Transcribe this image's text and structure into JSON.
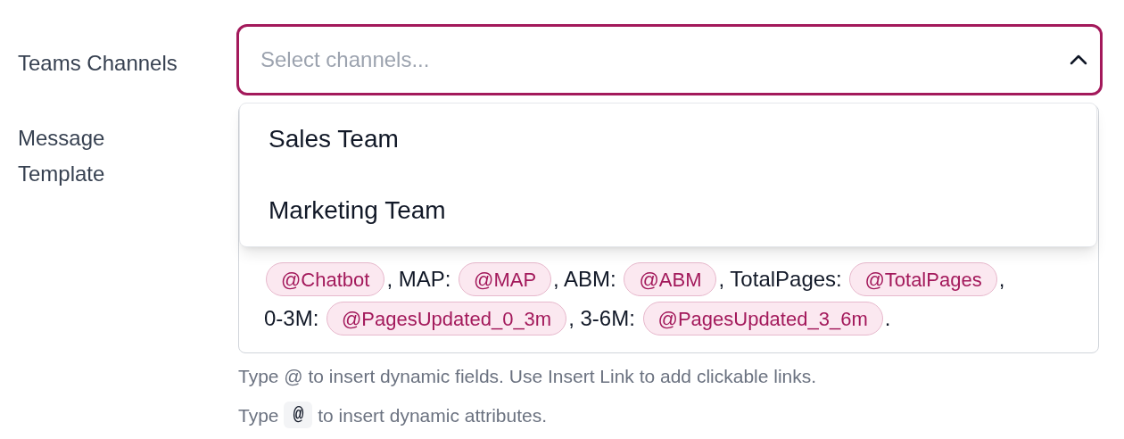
{
  "channels_field": {
    "label": "Teams Channels",
    "placeholder": "Select channels...",
    "expanded": true,
    "options": [
      {
        "label": "Sales Team"
      },
      {
        "label": "Marketing Team"
      }
    ]
  },
  "template_field": {
    "label": "Message Template",
    "lines": [
      [
        {
          "kind": "field",
          "text": "@Chatbot"
        },
        {
          "kind": "text",
          "text": ", MAP: "
        },
        {
          "kind": "field",
          "text": "@MAP"
        },
        {
          "kind": "text",
          "text": ", ABM: "
        },
        {
          "kind": "field",
          "text": "@ABM"
        },
        {
          "kind": "text",
          "text": ", TotalPages: "
        },
        {
          "kind": "field",
          "text": "@TotalPages"
        },
        {
          "kind": "text",
          "text": ","
        }
      ],
      [
        {
          "kind": "text",
          "text": "0-3M: "
        },
        {
          "kind": "field",
          "text": "@PagesUpdated_0_3m"
        },
        {
          "kind": "text",
          "text": ", 3-6M: "
        },
        {
          "kind": "field",
          "text": "@PagesUpdated_3_6m"
        },
        {
          "kind": "text",
          "text": "."
        }
      ]
    ],
    "hint": "Type @ to insert dynamic fields. Use Insert Link to add clickable links.",
    "hint_2": [
      {
        "kind": "text",
        "text": "Type "
      },
      {
        "kind": "key",
        "text": "@"
      },
      {
        "kind": "text",
        "text": " to insert dynamic attributes."
      }
    ]
  }
}
